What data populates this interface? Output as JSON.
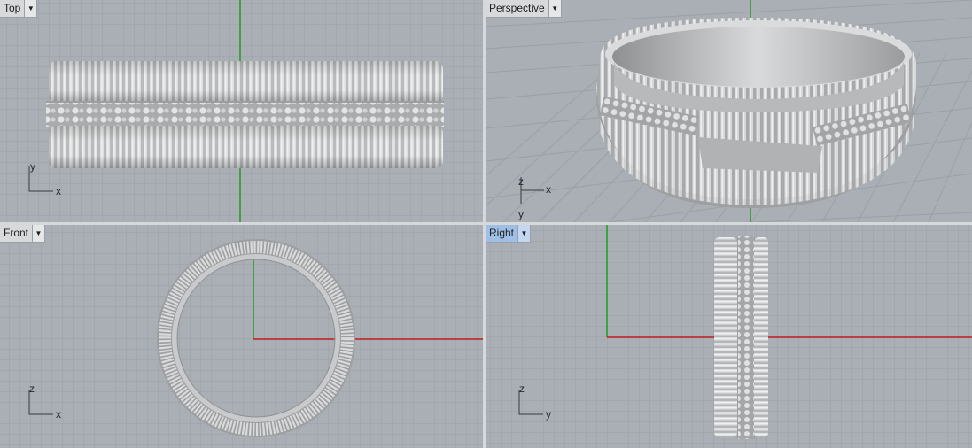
{
  "viewports": {
    "top": {
      "title": "Top",
      "axis_labels": [
        "y",
        "x"
      ]
    },
    "perspective": {
      "title": "Perspective",
      "axis_labels": [
        "z",
        "x",
        "y"
      ]
    },
    "front": {
      "title": "Front",
      "axis_labels": [
        "z",
        "x"
      ]
    },
    "right": {
      "title": "Right",
      "axis_labels": [
        "z",
        "y"
      ],
      "active": true
    }
  },
  "menu_icon": "dropdown-triangle-icon",
  "colors": {
    "background": "#a9afb5",
    "grid_minor": "#9ba1a7",
    "grid_major": "#8c9298",
    "x_axis": "#c02020",
    "y_axis": "#1e9e1e",
    "active_title": "#9fbfe6",
    "ring_metal": "#c3c5c6"
  }
}
